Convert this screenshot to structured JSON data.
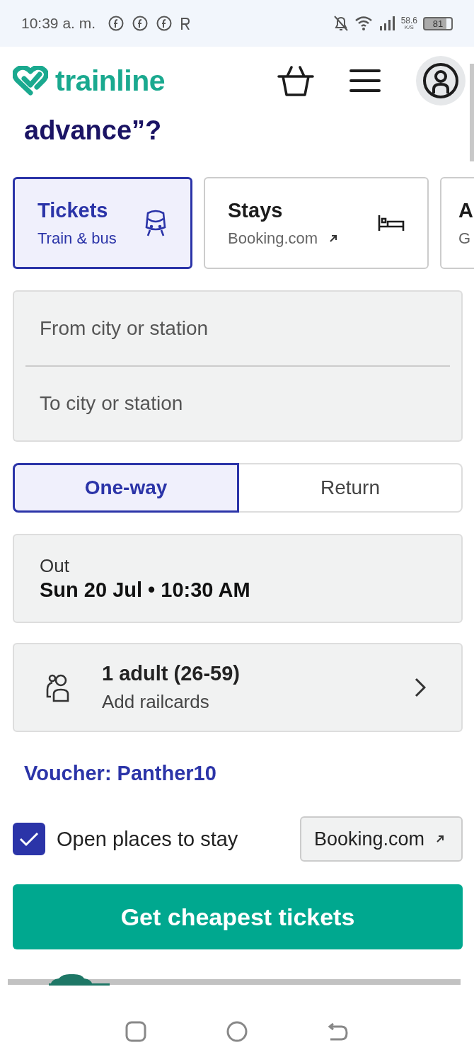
{
  "status_bar": {
    "time": "10:39 a. m.",
    "net_speed": "58.6",
    "net_unit": "K/S",
    "battery": "81"
  },
  "header": {
    "logo": "trainline"
  },
  "heading_fragment": "advance”?",
  "tabs": [
    {
      "title": "Tickets",
      "subtitle": "Train & bus",
      "kind": "train",
      "external": false,
      "selected": true
    },
    {
      "title": "Stays",
      "subtitle": "Booking.com",
      "kind": "bed",
      "external": true,
      "selected": false
    },
    {
      "title": "A",
      "subtitle": "G",
      "selected": false
    }
  ],
  "from": {
    "placeholder": "From city or station"
  },
  "to": {
    "placeholder": "To city or station"
  },
  "trip_types": [
    {
      "label": "One-way",
      "selected": true
    },
    {
      "label": "Return",
      "selected": false
    }
  ],
  "out": {
    "label": "Out",
    "value": "Sun 20 Jul • 10:30 AM"
  },
  "passengers": {
    "summary": "1 adult (26-59)",
    "action": "Add railcards"
  },
  "voucher": "Voucher: Panther10",
  "stays_option": {
    "label": "Open places to stay",
    "checked": true,
    "button": "Booking.com"
  },
  "submit": "Get cheapest tickets"
}
